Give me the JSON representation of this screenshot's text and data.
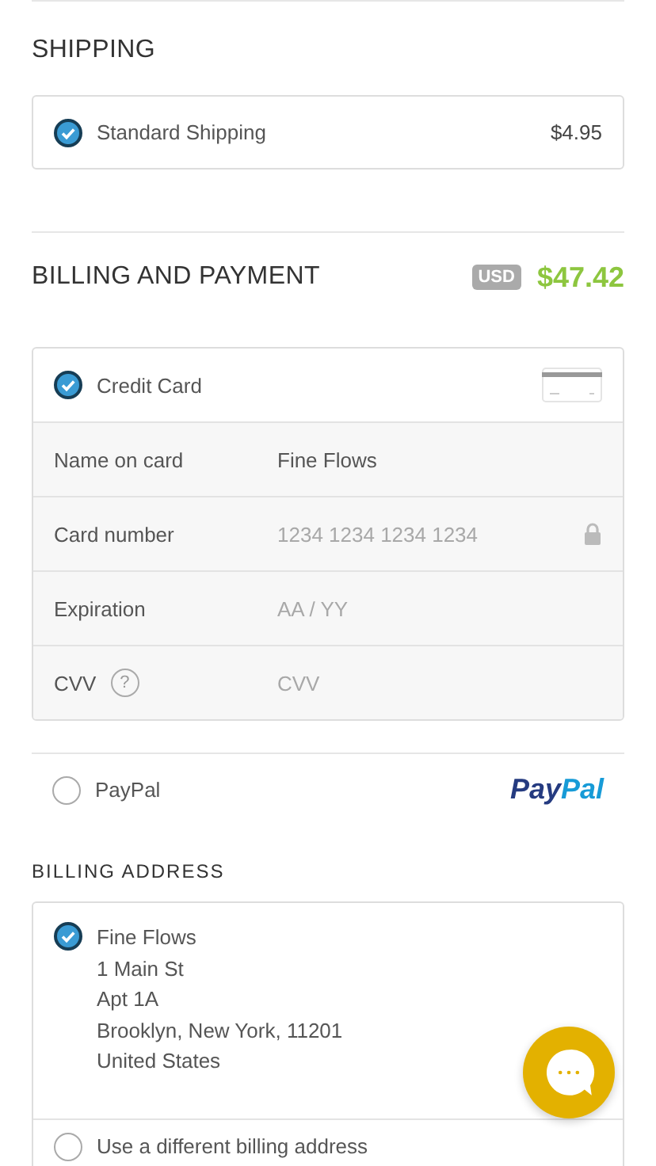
{
  "shipping": {
    "title": "SHIPPING",
    "options": [
      {
        "label": "Standard Shipping",
        "price": "$4.95",
        "selected": true
      }
    ]
  },
  "billing": {
    "title": "BILLING AND PAYMENT",
    "currency": "USD",
    "total": "$47.42"
  },
  "payment_methods": [
    {
      "kind": "card",
      "label": "Credit Card",
      "selected": true,
      "fields": [
        {
          "label": "Name on card",
          "value": "Fine Flows"
        },
        {
          "label": "Card number",
          "placeholder": "1234 1234 1234 1234",
          "secure": true
        },
        {
          "label": "Expiration",
          "placeholder": "AA / YY"
        },
        {
          "label": "CVV",
          "placeholder": "CVV",
          "help": "?"
        }
      ]
    },
    {
      "kind": "paypal",
      "label": "PayPal",
      "selected": false,
      "logo_parts": [
        "Pay",
        "Pal"
      ]
    }
  ],
  "billing_address": {
    "title": "BILLING ADDRESS",
    "options": [
      {
        "kind": "address",
        "selected": true,
        "lines": [
          "Fine Flows",
          "1 Main St",
          "Apt 1A",
          "Brooklyn, New York, 11201",
          "United States"
        ]
      },
      {
        "kind": "other",
        "selected": false,
        "label": "Use a different billing address"
      }
    ]
  }
}
